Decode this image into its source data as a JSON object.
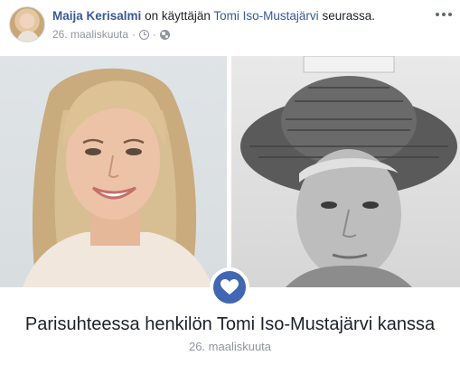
{
  "post": {
    "actor_name": "Maija Kerisalmi",
    "action_text": "on käyttäjän",
    "target_name": "Tomi Iso-Mustajärvi",
    "action_suffix": "seurassa.",
    "date": "26. maaliskuuta",
    "separator": "·",
    "privacy_icon": "globe-icon",
    "time_icon": "clock-icon",
    "menu_icon": "more-options-icon"
  },
  "life_event": {
    "icon": "heart-icon",
    "title": "Parisuhteessa henkilön Tomi Iso-Mustajärvi kanssa",
    "date": "26. maaliskuuta"
  },
  "colors": {
    "link": "#385898",
    "meta_text": "#90949c",
    "badge": "#4267b2"
  }
}
